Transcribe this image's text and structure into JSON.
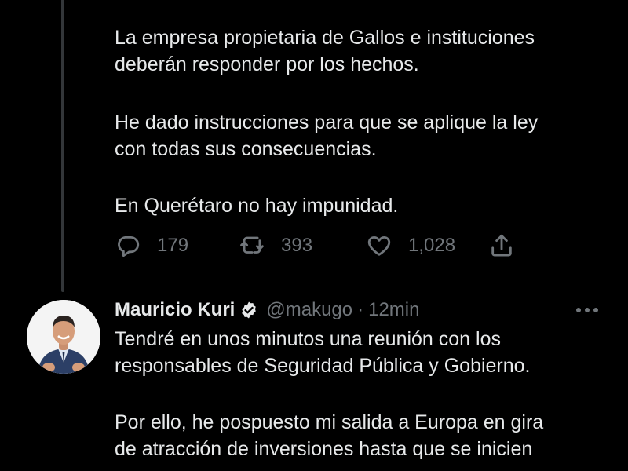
{
  "colors": {
    "background": "#000000",
    "text": "#e7e9ea",
    "muted": "#71767b",
    "thread_line": "#333639",
    "verified": "#e7e9ea"
  },
  "tweet1": {
    "paragraph1": "La empresa propietaria de Gallos e instituciones\ndeberán responder por los hechos.",
    "paragraph2": "He dado instrucciones para que se aplique la ley\ncon todas sus consecuencias.",
    "paragraph3": "En Querétaro no hay impunidad.",
    "actions": {
      "reply_icon": "reply-icon",
      "reply_count": "179",
      "retweet_icon": "retweet-icon",
      "retweet_count": "393",
      "like_icon": "heart-icon",
      "like_count": "1,028",
      "share_icon": "share-icon"
    }
  },
  "tweet2": {
    "author_name": "Mauricio Kuri",
    "verified_icon": "verified-badge-icon",
    "handle": "@makugo",
    "separator": "·",
    "time": "12min",
    "more_icon": "more-icon",
    "paragraph1": "Tendré en unos minutos una reunión con los\nresponsables de Seguridad Pública y Gobierno.",
    "paragraph2": "Por ello, he pospuesto mi salida a Europa en gira\nde atracción de inversiones hasta que se inicien"
  }
}
